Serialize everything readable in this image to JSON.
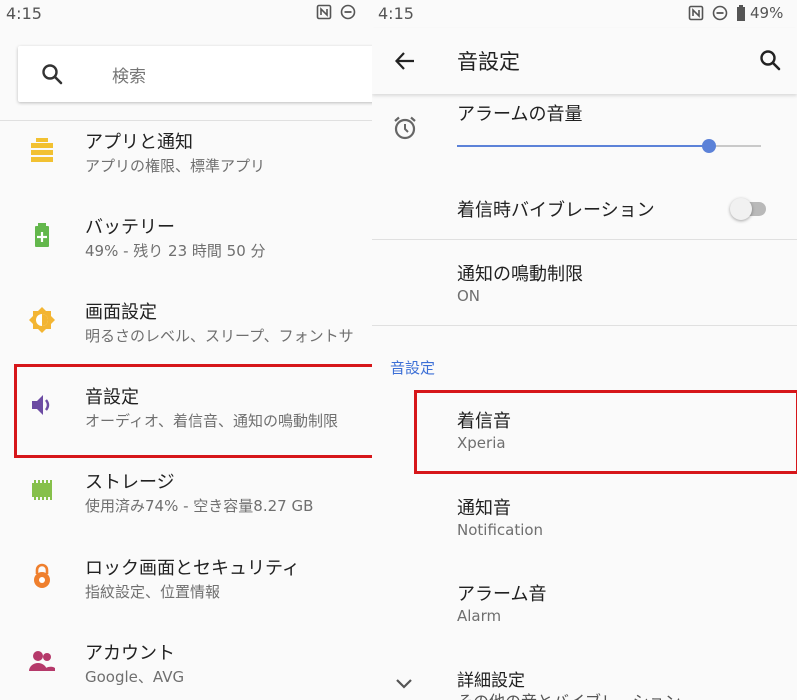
{
  "left": {
    "status": {
      "time": "4:15"
    },
    "search": {
      "placeholder": "検索"
    },
    "items": [
      {
        "title": "アプリと通知",
        "subtitle": "アプリの権限、標準アプリ",
        "icon": "apps-icon",
        "color": "#f2c131"
      },
      {
        "title": "バッテリー",
        "subtitle": "49% - 残り 23 時間  50 分",
        "icon": "battery-icon",
        "color": "#63b74c"
      },
      {
        "title": "画面設定",
        "subtitle": "明るさのレベル、スリープ、フォントサ",
        "icon": "brightness-icon",
        "color": "#f3b533"
      },
      {
        "title": "音設定",
        "subtitle": "オーディオ、着信音、通知の鳴動制限",
        "icon": "volume-icon",
        "color": "#6c4ba3"
      },
      {
        "title": "ストレージ",
        "subtitle": "使用済み74% - 空き容量8.27 GB",
        "icon": "storage-icon",
        "color": "#86c04a"
      },
      {
        "title": "ロック画面とセキュリティ",
        "subtitle": "指紋設定、位置情報",
        "icon": "lock-icon",
        "color": "#ef7f2d"
      },
      {
        "title": "アカウント",
        "subtitle": "Google、AVG",
        "icon": "account-icon",
        "color": "#b5396a"
      }
    ]
  },
  "right": {
    "status": {
      "time": "4:15",
      "battery": "49%"
    },
    "appbar": {
      "title": "音設定"
    },
    "alarm_volume": {
      "title": "アラームの音量",
      "level": 0.83
    },
    "vibrate": {
      "title": "着信時バイブレーション",
      "on": false
    },
    "dnd": {
      "title": "通知の鳴動制限",
      "value": "ON"
    },
    "section_header": "音設定",
    "ringtone": {
      "title": "着信音",
      "value": "Xperia"
    },
    "notification_sound": {
      "title": "通知音",
      "value": "Notification"
    },
    "alarm_sound": {
      "title": "アラーム音",
      "value": "Alarm"
    },
    "advanced": {
      "title": "詳細設定",
      "subtitle": "その他の音とバイブレーション"
    }
  },
  "colors": {
    "accent": "#3c6fd6",
    "highlight": "#d6161a",
    "slider": "#5c82d8"
  }
}
